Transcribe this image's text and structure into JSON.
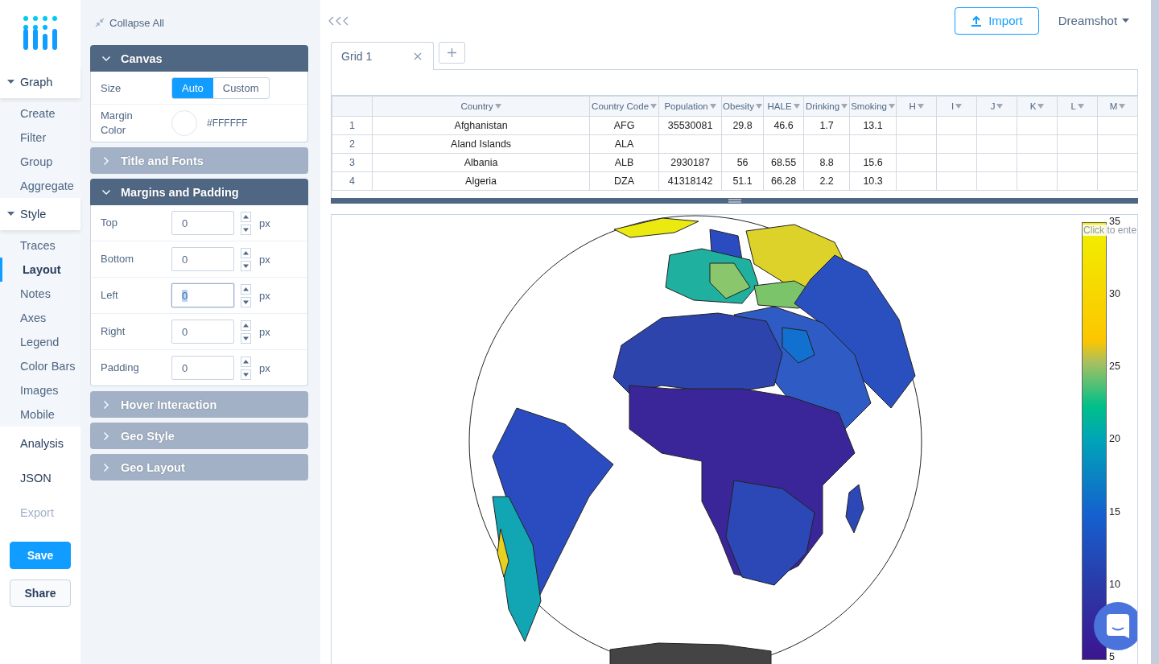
{
  "sidebar": {
    "groups": [
      {
        "label": "Graph",
        "expanded": true,
        "items": [
          {
            "label": "Create",
            "selected": false
          },
          {
            "label": "Filter",
            "selected": false
          },
          {
            "label": "Group",
            "selected": false
          },
          {
            "label": "Aggregate",
            "selected": false
          }
        ]
      },
      {
        "label": "Style",
        "expanded": true,
        "items": [
          {
            "label": "Traces",
            "selected": false
          },
          {
            "label": "Layout",
            "selected": true
          },
          {
            "label": "Notes",
            "selected": false
          },
          {
            "label": "Axes",
            "selected": false
          },
          {
            "label": "Legend",
            "selected": false
          },
          {
            "label": "Color Bars",
            "selected": false
          },
          {
            "label": "Images",
            "selected": false
          },
          {
            "label": "Mobile",
            "selected": false
          }
        ]
      }
    ],
    "links": [
      {
        "label": "Analysis",
        "disabled": false
      },
      {
        "label": "JSON",
        "disabled": false
      },
      {
        "label": "Export",
        "disabled": true
      }
    ],
    "buttons": [
      {
        "label": "Save",
        "kind": "primary"
      },
      {
        "label": "Share",
        "kind": "secondary"
      }
    ]
  },
  "panel": {
    "collapse_all": "Collapse All",
    "sections": [
      {
        "title": "Canvas",
        "expanded": true,
        "rows": [
          {
            "kind": "toggle",
            "label": "Size",
            "options": [
              {
                "label": "Auto",
                "selected": true
              },
              {
                "label": "Custom",
                "selected": false
              }
            ]
          },
          {
            "kind": "color",
            "label": "Margin Color",
            "value": "#FFFFFF"
          }
        ]
      },
      {
        "title": "Title and Fonts",
        "expanded": false
      },
      {
        "title": "Margins and Padding",
        "expanded": true,
        "rows": [
          {
            "kind": "number",
            "label": "Top",
            "value": "0",
            "unit": "px",
            "focused": false
          },
          {
            "kind": "number",
            "label": "Bottom",
            "value": "0",
            "unit": "px",
            "focused": false
          },
          {
            "kind": "number",
            "label": "Left",
            "value": "0",
            "unit": "px",
            "focused": true
          },
          {
            "kind": "number",
            "label": "Right",
            "value": "0",
            "unit": "px",
            "focused": false
          },
          {
            "kind": "number",
            "label": "Padding",
            "value": "0",
            "unit": "px",
            "focused": false
          }
        ]
      },
      {
        "title": "Hover Interaction",
        "expanded": false
      },
      {
        "title": "Geo Style",
        "expanded": false
      },
      {
        "title": "Geo Layout",
        "expanded": false
      }
    ]
  },
  "toolbar": {
    "import": "Import",
    "user": "Dreamshot"
  },
  "grid_tabs": [
    {
      "label": "Grid 1",
      "selected": true
    }
  ],
  "table": {
    "columns": [
      "Country",
      "Country Code",
      "Population",
      "Obesity",
      "HALE",
      "Drinking",
      "Smoking",
      "H",
      "I",
      "J",
      "K",
      "L",
      "M"
    ],
    "rows": [
      {
        "number": "1",
        "cells": [
          "Afghanistan",
          "AFG",
          "35530081",
          "29.8",
          "46.6",
          "1.7",
          "13.1",
          "",
          "",
          "",
          "",
          "",
          ""
        ]
      },
      {
        "number": "2",
        "cells": [
          "Aland Islands",
          "ALA",
          "",
          "",
          "",
          "",
          "",
          "",
          "",
          "",
          "",
          "",
          ""
        ]
      },
      {
        "number": "3",
        "cells": [
          "Albania",
          "ALB",
          "2930187",
          "56",
          "68.55",
          "8.8",
          "15.6",
          "",
          "",
          "",
          "",
          "",
          ""
        ]
      },
      {
        "number": "4",
        "cells": [
          "Algeria",
          "DZA",
          "41318142",
          "51.1",
          "66.28",
          "2.2",
          "10.3",
          "",
          "",
          "",
          "",
          "",
          ""
        ]
      }
    ]
  },
  "plot": {
    "colorbar": {
      "title": "Click to ente",
      "ticks": [
        "35",
        "30",
        "25",
        "20",
        "15",
        "10",
        "5"
      ]
    }
  }
}
